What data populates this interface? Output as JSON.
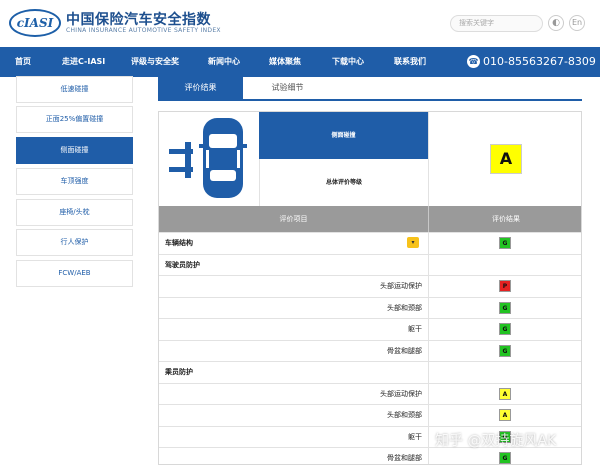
{
  "header": {
    "logo_mark": "cIASI",
    "title": "中国保险汽车安全指数",
    "subtitle": "CHINA INSURANCE AUTOMOTIVE SAFETY INDEX",
    "search_placeholder": "搜索关键字",
    "lang_label": "En"
  },
  "nav": {
    "items": [
      "首页",
      "走进C-IASI",
      "评级与安全奖",
      "新闻中心",
      "媒体聚焦",
      "下载中心",
      "联系我们"
    ],
    "phone": "010-85563267-8309"
  },
  "sidebar": {
    "items": [
      "低速碰撞",
      "正面25%偏置碰撞",
      "侧面碰撞",
      "车顶强度",
      "座椅/头枕",
      "行人保护",
      "FCW/AEB"
    ],
    "active_index": 2
  },
  "tabs": {
    "active": "评价结果",
    "inactive": "试验细节"
  },
  "summary": {
    "test_name": "侧面碰撞",
    "overall_label": "总体评价等级",
    "overall_grade": "A",
    "overall_grade_color": "#ffff00"
  },
  "table": {
    "col_item": "评价项目",
    "col_result": "评价结果",
    "rows": [
      {
        "label": "车辆结构",
        "grade": "G",
        "section": true,
        "expand": "▾"
      },
      {
        "label": "驾驶员防护",
        "grade": "",
        "section": true
      },
      {
        "label": "头部运动保护",
        "grade": "P"
      },
      {
        "label": "头部和颈部",
        "grade": "G"
      },
      {
        "label": "躯干",
        "grade": "G"
      },
      {
        "label": "骨盆和腿部",
        "grade": "G"
      },
      {
        "label": "乘员防护",
        "grade": "",
        "section": true
      },
      {
        "label": "头部运动保护",
        "grade": "A"
      },
      {
        "label": "头部和颈部",
        "grade": "A"
      },
      {
        "label": "躯干",
        "grade": "G"
      },
      {
        "label": "骨盆和腿部",
        "grade": "G"
      }
    ],
    "grade_colors": {
      "G": "#22c322",
      "P": "#e52222",
      "A": "#ffff33"
    }
  },
  "watermark": "知乎 @双持旋风AK"
}
